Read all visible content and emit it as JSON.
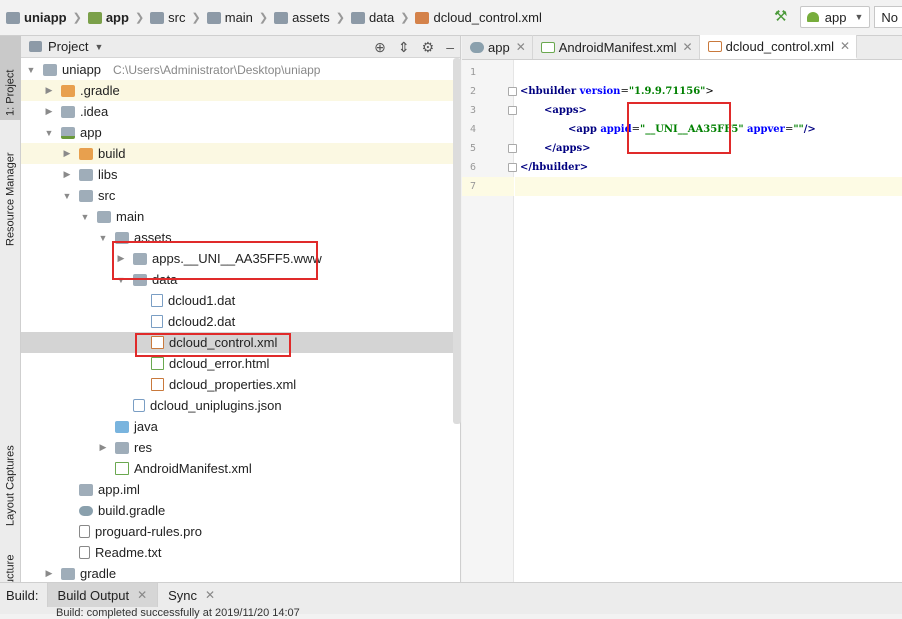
{
  "breadcrumb": [
    "uniapp",
    "app",
    "src",
    "main",
    "assets",
    "data",
    "dcloud_control.xml"
  ],
  "run_config": {
    "label": "app",
    "next_label": "No"
  },
  "left_tools": {
    "project": "1: Project",
    "resource_manager": "Resource Manager",
    "layout_captures": "Layout Captures",
    "structure": "Z: Structure"
  },
  "project_panel": {
    "title": "Project"
  },
  "tree": [
    {
      "label": "uniapp",
      "path": "C:\\Users\\Administrator\\Desktop\\uniapp"
    },
    {
      "label": ".gradle"
    },
    {
      "label": ".idea"
    },
    {
      "label": "app"
    },
    {
      "label": "build"
    },
    {
      "label": "libs"
    },
    {
      "label": "src"
    },
    {
      "label": "main"
    },
    {
      "label": "assets"
    },
    {
      "label": "apps.__UNI__AA35FF5.www"
    },
    {
      "label": "data"
    },
    {
      "label": "dcloud1.dat"
    },
    {
      "label": "dcloud2.dat"
    },
    {
      "label": "dcloud_control.xml"
    },
    {
      "label": "dcloud_error.html"
    },
    {
      "label": "dcloud_properties.xml"
    },
    {
      "label": "dcloud_uniplugins.json"
    },
    {
      "label": "java"
    },
    {
      "label": "res"
    },
    {
      "label": "AndroidManifest.xml"
    },
    {
      "label": "app.iml"
    },
    {
      "label": "build.gradle"
    },
    {
      "label": "proguard-rules.pro"
    },
    {
      "label": "Readme.txt"
    },
    {
      "label": "gradle"
    }
  ],
  "editor": {
    "tabs": [
      "app",
      "AndroidManifest.xml",
      "dcloud_control.xml"
    ],
    "line_numbers": [
      "1",
      "2",
      "3",
      "4",
      "5",
      "6",
      "7"
    ],
    "code": {
      "l2_tag": "<hbuilder",
      "l2_attr": "version",
      "l2_val": "\"1.9.9.71156\"",
      "l3": "<apps>",
      "l4_tag": "<app",
      "l4_attr1": "appid",
      "l4_val1": "\"__UNI__AA35FF5\"",
      "l4_attr2": "appver",
      "l4_val2": "\"\"",
      "l4_end": "/>",
      "l5": "</apps>",
      "l6": "</hbuilder>"
    }
  },
  "bottom": {
    "label": "Build:",
    "tabs": [
      "Build Output",
      "Sync"
    ],
    "status": "Build: completed successfully at 2019/11/20 14:07"
  },
  "colors": {
    "highlight_box": "#e02a2a",
    "selected_row": "#d4d4d4",
    "xml_value": "#008000",
    "xml_tag": "#000080"
  }
}
